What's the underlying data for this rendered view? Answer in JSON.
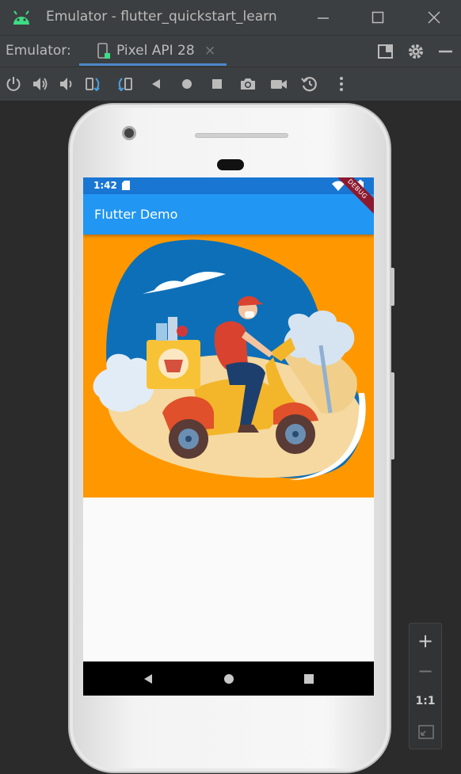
{
  "window": {
    "title": "Emulator - flutter_quickstart_learn"
  },
  "tabbar": {
    "label": "Emulator:",
    "active_tab": "Pixel API 28",
    "close_glyph": "×"
  },
  "toolbar": {
    "icons": [
      "power-icon",
      "volume-up-icon",
      "volume-down-icon",
      "rotate-left-icon",
      "rotate-right-icon",
      "back-icon",
      "home-icon",
      "overview-icon",
      "screenshot-icon",
      "screen-record-icon",
      "snapshot-icon",
      "more-icon"
    ]
  },
  "device": {
    "status_time": "1:42",
    "app_title": "Flutter Demo",
    "debug_banner": "DEBUG"
  },
  "zoom": {
    "zoom_in": "+",
    "zoom_out": "−",
    "one_to_one": "1:1"
  },
  "colors": {
    "ide_bg": "#3c3f41",
    "canvas_bg": "#2b2b2b",
    "status_bar": "#1976d2",
    "app_bar": "#2196f3",
    "hero_bg": "#ff9800",
    "accent": "#4a88c7"
  }
}
